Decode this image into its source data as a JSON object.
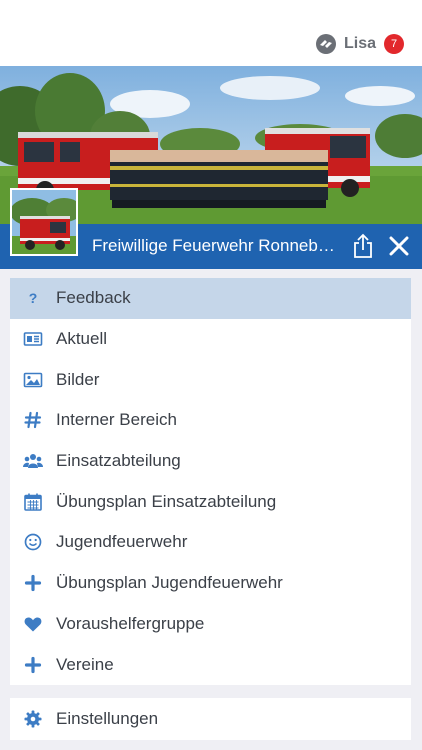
{
  "header": {
    "user_name": "Lisa",
    "notification_count": "7"
  },
  "title_bar": {
    "title": "Freiwillige Feuerwehr Ronneb…"
  },
  "menu": {
    "items": [
      {
        "label": "Feedback",
        "icon": "question-icon",
        "active": true
      },
      {
        "label": "Aktuell",
        "icon": "newspaper-icon"
      },
      {
        "label": "Bilder",
        "icon": "image-icon"
      },
      {
        "label": "Interner Bereich",
        "icon": "hashtag-icon"
      },
      {
        "label": "Einsatzabteilung",
        "icon": "group-icon"
      },
      {
        "label": "Übungsplan Einsatzabteilung",
        "icon": "calendar-icon"
      },
      {
        "label": "Jugendfeuerwehr",
        "icon": "smiley-icon"
      },
      {
        "label": "Übungsplan Jugendfeuerwehr",
        "icon": "plus-icon"
      },
      {
        "label": "Voraushelfergruppe",
        "icon": "heart-icon"
      },
      {
        "label": "Vereine",
        "icon": "plus-icon"
      }
    ]
  },
  "settings": {
    "label": "Einstellungen",
    "icon": "gear-icon"
  },
  "colors": {
    "accent": "#1f63b0",
    "icon": "#3d7cc4",
    "active_row": "#c5d6e9",
    "badge": "#e2282c"
  }
}
